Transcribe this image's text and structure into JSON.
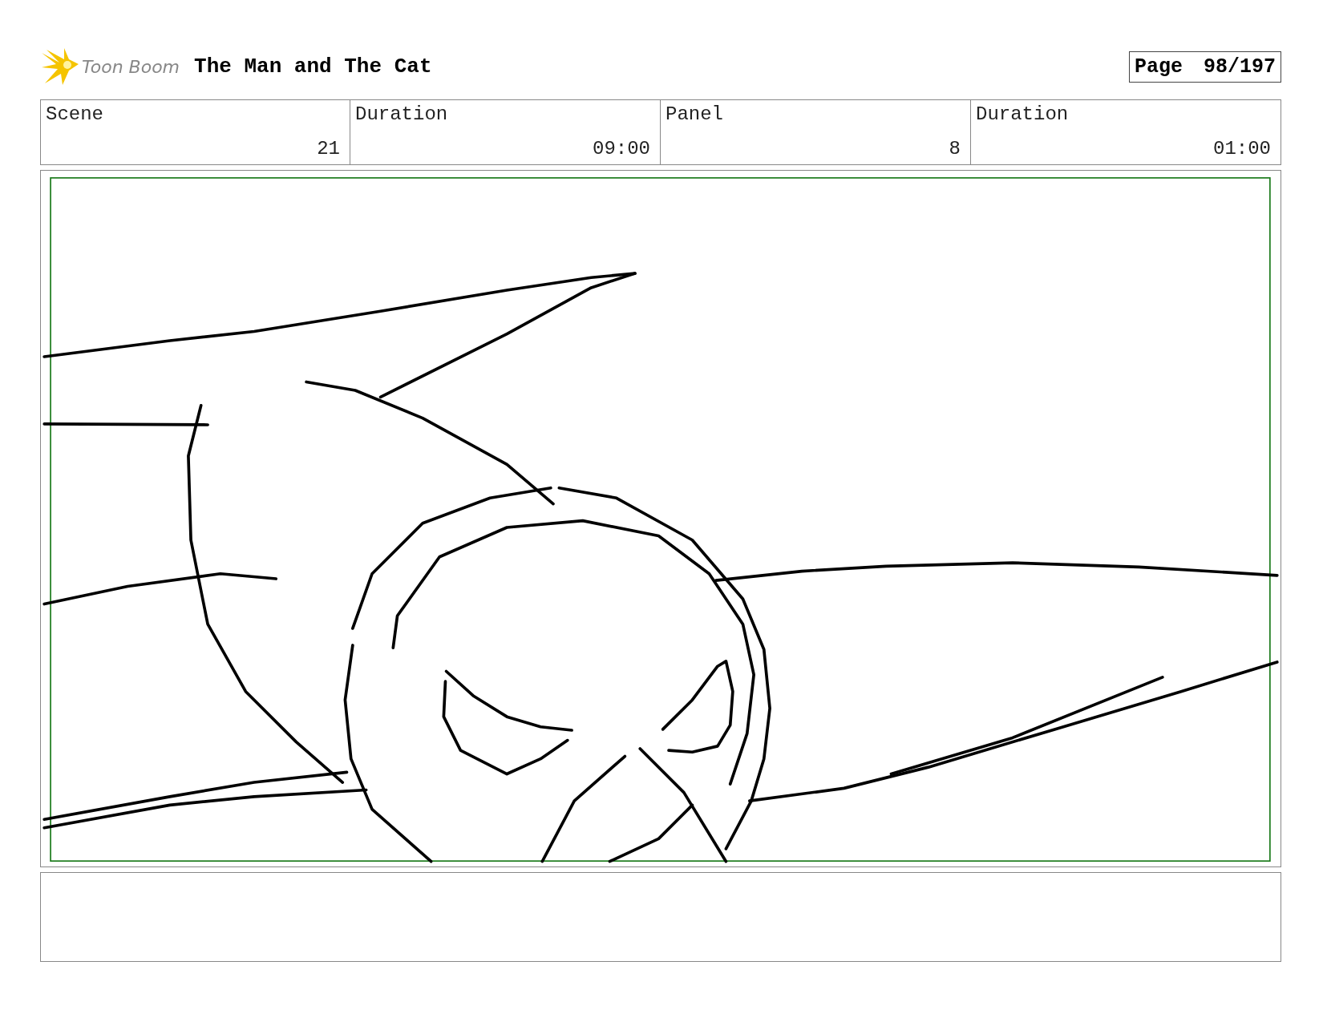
{
  "header": {
    "logo_text": "Toon Boom",
    "title": "The Man and The Cat",
    "page_label": "Page",
    "page_number": "98/197"
  },
  "info_table": {
    "headings": [
      "Scene",
      "Duration",
      "Panel",
      "Duration"
    ],
    "values": [
      "21",
      "09:00",
      "8",
      "01:00"
    ]
  }
}
